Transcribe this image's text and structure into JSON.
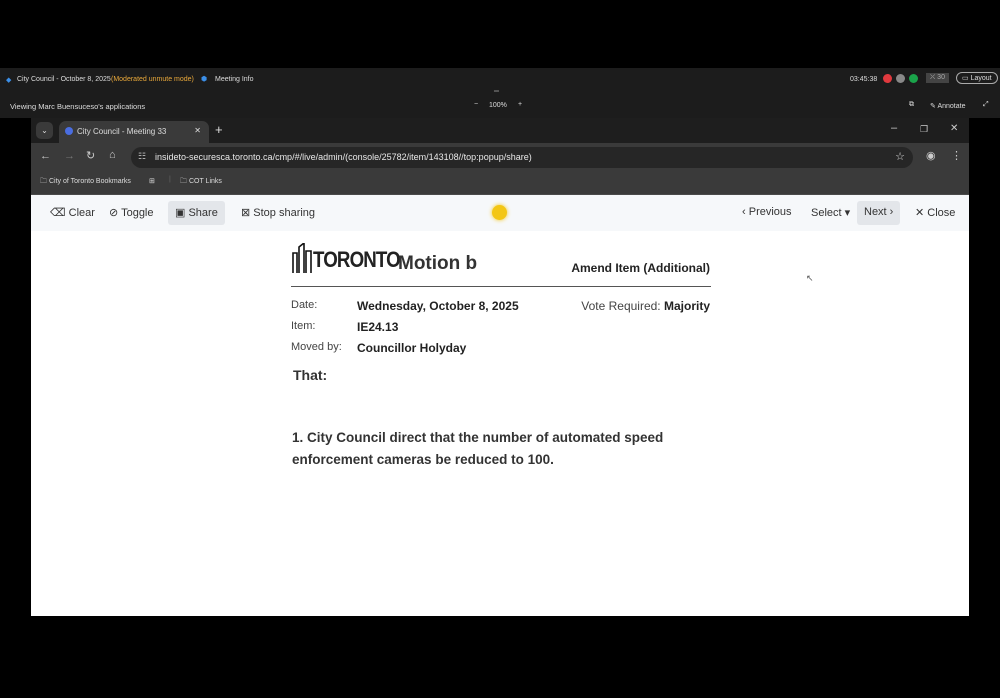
{
  "meeting_bar": {
    "title": "City Council - October 8, 2025",
    "mode": "(Moderated unmute mode)",
    "meeting_info": "Meeting Info",
    "clock": "03:45:38",
    "participants": "30",
    "layout": "Layout",
    "viewing": "Viewing Marc Buensuceso's applications",
    "zoom": "100%",
    "annotate": "Annotate",
    "status_colors": [
      "#e0393e",
      "#888888",
      "#1aa34a"
    ]
  },
  "browser": {
    "tab_title": "City Council - Meeting 33",
    "url": "insideto-securesca.toronto.ca/cmp/#/live/admin/(console/25782/item/143108//top:popup/share)",
    "bookmarks": [
      "City of Toronto Bookmarks",
      "COT Links"
    ]
  },
  "toolbar": {
    "clear": "Clear",
    "toggle": "Toggle",
    "share": "Share",
    "stop_sharing": "Stop sharing",
    "previous": "Previous",
    "select": "Select",
    "next": "Next",
    "close": "Close"
  },
  "doc": {
    "logo": "TORONTO",
    "title": "Motion b",
    "type": "Amend Item (Additional)",
    "date_label": "Date:",
    "date": "Wednesday, October 8, 2025",
    "vote_label": "Vote Required:",
    "vote": "Majority",
    "item_label": "Item:",
    "item": "IE24.13",
    "moved_label": "Moved by:",
    "moved": "Councillor Holyday",
    "that": "That:",
    "motion_text": "1. City Council direct that the number of automated speed enforcement cameras be reduced to 100."
  }
}
